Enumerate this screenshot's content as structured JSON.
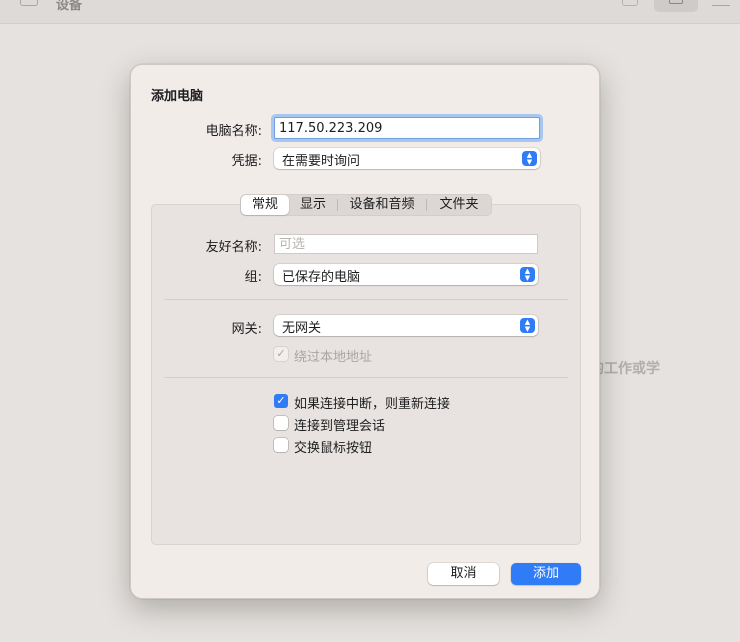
{
  "app": {
    "title": "设备",
    "background_text": "的工作或学"
  },
  "dialog": {
    "title": "添加电脑",
    "pc_name": {
      "label": "电脑名称:",
      "value": "117.50.223.209"
    },
    "credentials": {
      "label": "凭据:",
      "value": "在需要时询问"
    },
    "tabs": [
      {
        "label": "常规",
        "active": true
      },
      {
        "label": "显示",
        "active": false
      },
      {
        "label": "设备和音频",
        "active": false
      },
      {
        "label": "文件夹",
        "active": false
      }
    ],
    "friendly_name": {
      "label": "友好名称:",
      "placeholder": "可选",
      "value": ""
    },
    "group": {
      "label": "组:",
      "value": "已保存的电脑"
    },
    "gateway": {
      "label": "网关:",
      "value": "无网关"
    },
    "bypass_local": {
      "label": "绕过本地地址",
      "checked": true,
      "disabled": true
    },
    "reconnect": {
      "label": "如果连接中断，则重新连接",
      "checked": true
    },
    "admin_session": {
      "label": "连接到管理会话",
      "checked": false
    },
    "swap_mouse": {
      "label": "交换鼠标按钮",
      "checked": false
    },
    "cancel_label": "取消",
    "add_label": "添加"
  },
  "colors": {
    "accent": "#2f7cf6",
    "dialog_bg": "#f2ece9",
    "window_bg": "#e6e2df"
  }
}
